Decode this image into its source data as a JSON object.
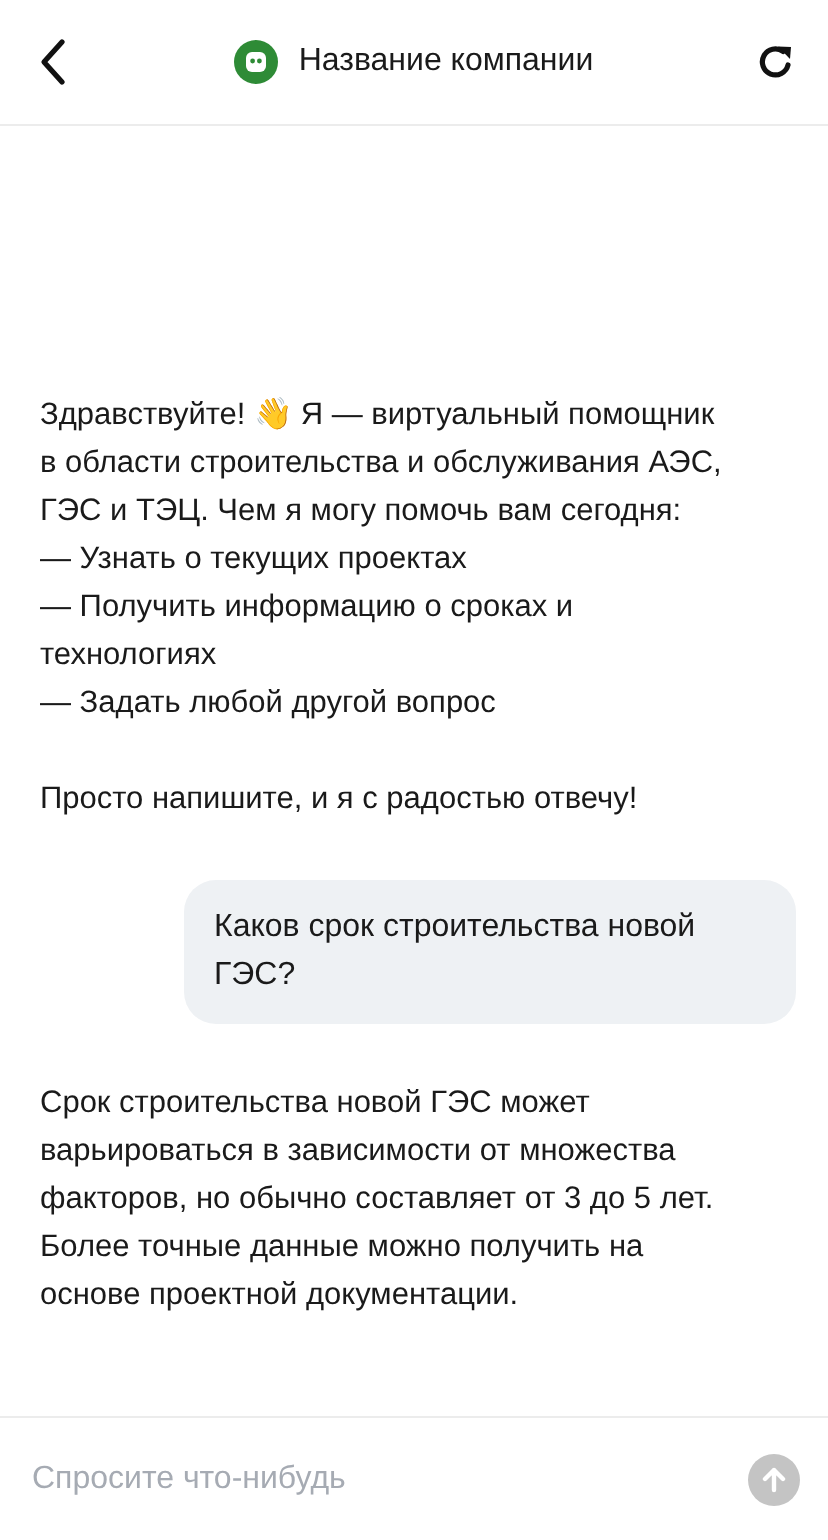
{
  "header": {
    "title": "Название компании"
  },
  "messages": [
    {
      "kind": "bot",
      "text": "Здравствуйте! 👋 Я — виртуальный помощник\nв области строительства и обслуживания АЭС,\nГЭС и ТЭЦ. Чем я могу помочь вам сегодня:\n— Узнать о текущих проектах\n— Получить информацию о сроках и\nтехнологиях\n— Задать любой другой вопрос\n\nПросто напишите, и я с радостью отвечу!"
    },
    {
      "kind": "user",
      "text": "Каков срок строительства новой\nГЭС?"
    },
    {
      "kind": "bot",
      "text": "Срок строительства новой ГЭС может\nварьироваться в зависимости от множества\nфакторов, но обычно составляет от 3 до 5 лет.\nБолее точные данные можно получить на\nоснове проектной документации."
    }
  ],
  "composer": {
    "placeholder": "Спросите что-нибудь",
    "send_disabled": true
  }
}
